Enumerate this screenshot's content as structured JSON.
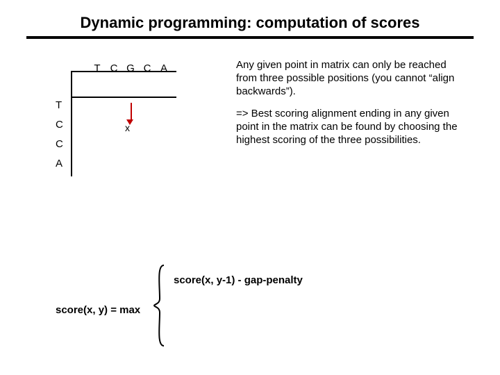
{
  "title": "Dynamic programming: computation of scores",
  "grid": {
    "col_headers": [
      "T",
      "C",
      "G",
      "C",
      "A"
    ],
    "row_headers": [
      "T",
      "C",
      "C",
      "A"
    ],
    "marked_cell_label": "x"
  },
  "paragraphs": {
    "p1": "Any given point in matrix can only be reached from three possible positions (you cannot “align backwards”).",
    "p2": "=> Best scoring alignment ending in any given point in the matrix can be found by choosing the highest scoring of the three possibilities."
  },
  "formula": {
    "lhs": "score(x, y) = max",
    "cases": {
      "c1": "score(x, y-1) - gap-penalty"
    }
  },
  "colors": {
    "arrow": "#c00000"
  }
}
